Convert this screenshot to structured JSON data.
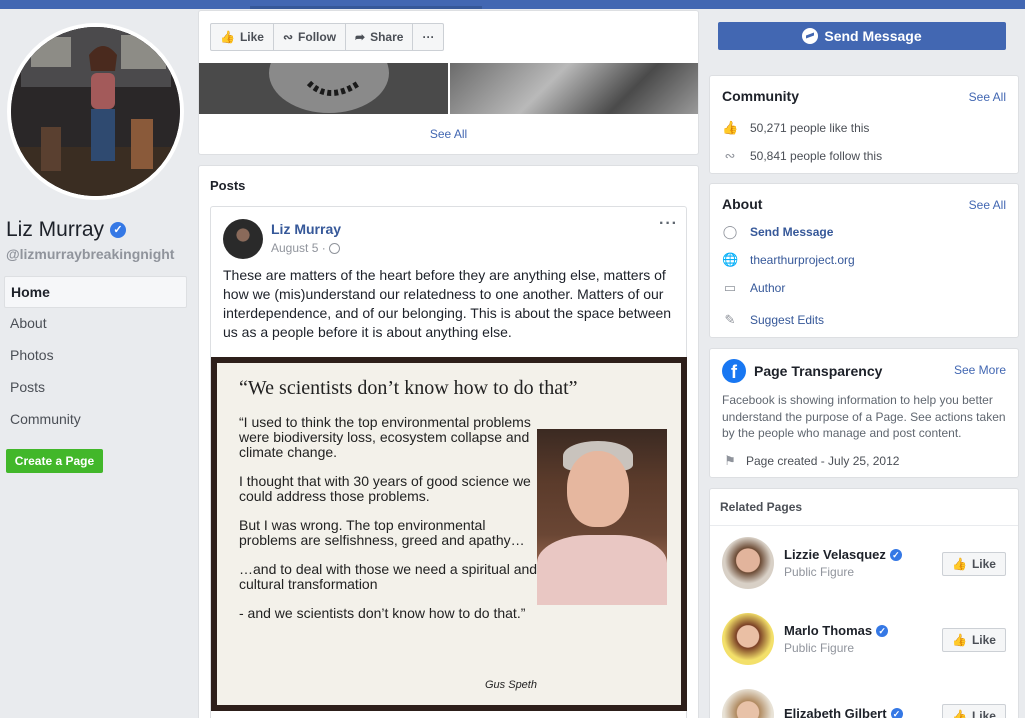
{
  "profile": {
    "name": "Liz Murray",
    "handle": "@lizmurraybreakingnight"
  },
  "left_nav": {
    "items": [
      {
        "label": "Home",
        "active": true
      },
      {
        "label": "About"
      },
      {
        "label": "Photos"
      },
      {
        "label": "Posts"
      },
      {
        "label": "Community"
      }
    ],
    "create_page": "Create a Page"
  },
  "action_bar": {
    "like": "Like",
    "follow": "Follow",
    "share": "Share",
    "more": "···",
    "send_message": "Send Message"
  },
  "photos": {
    "see_all": "See All"
  },
  "posts": {
    "title": "Posts",
    "post": {
      "author": "Liz Murray",
      "date": "August 5 ·",
      "text": "These are matters of the heart before they are anything else, matters of how we (mis)understand our relatedness to one another. Matters of our interdependence, and of our belonging. This is about the space between us as a people before it is about anything else.",
      "more": "···",
      "image": {
        "title": "“We scientists don’t know how to do that”",
        "paragraphs": [
          "“I used to think the top environmental problems were biodiversity loss, ecosystem collapse and climate change.",
          "I thought that with 30 years of good science we could address those problems.",
          "But I was wrong. The top environmental problems are selfishness, greed and apathy…",
          "…and to deal with those we need a spiritual and cultural transformation",
          "- and we scientists don’t know how to do that.”"
        ],
        "signature": "Gus Speth"
      }
    }
  },
  "community": {
    "title": "Community",
    "see_all": "See All",
    "likes": "50,271 people like this",
    "follows": "50,841 people follow this"
  },
  "about": {
    "title": "About",
    "see_all": "See All",
    "send_message": "Send Message",
    "website": "thearthurproject.org",
    "category": "Author",
    "suggest": "Suggest Edits"
  },
  "transparency": {
    "title": "Page Transparency",
    "see_more": "See More",
    "description": "Facebook is showing information to help you better understand the purpose of a Page. See actions taken by the people who manage and post content.",
    "created": "Page created - July 25, 2012"
  },
  "related": {
    "title": "Related Pages",
    "like_label": "Like",
    "pages": [
      {
        "name": "Lizzie Velasquez",
        "category": "Public Figure"
      },
      {
        "name": "Marlo Thomas",
        "category": "Public Figure"
      },
      {
        "name": "Elizabeth Gilbert",
        "category": ""
      }
    ]
  },
  "colors": {
    "brand": "#4267b2",
    "link": "#365899",
    "create_page_green": "#42b72a",
    "verified": "#3578e5"
  }
}
